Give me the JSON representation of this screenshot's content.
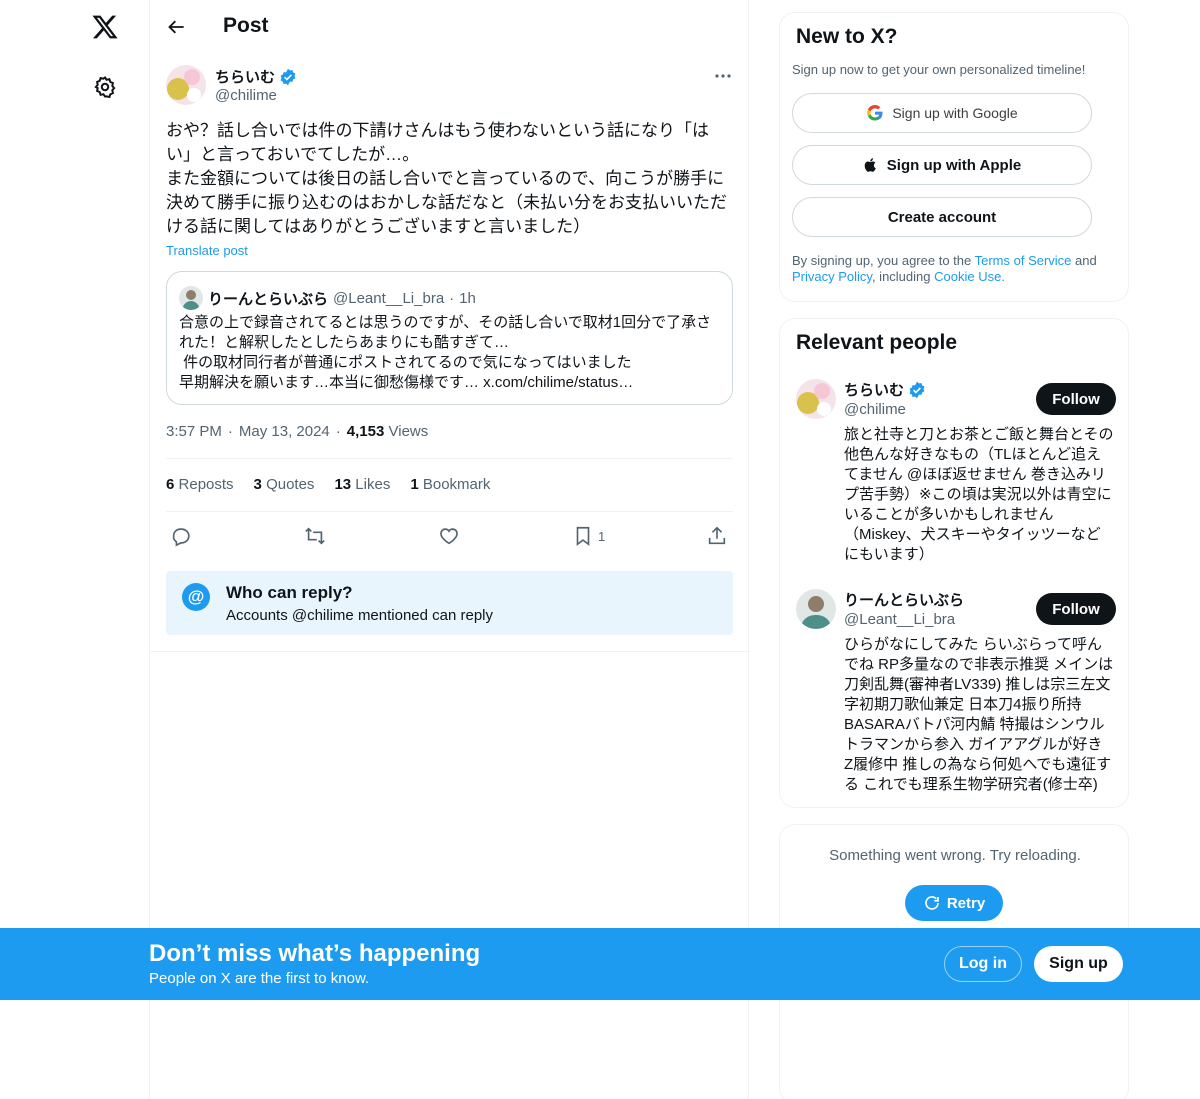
{
  "colors": {
    "accent": "#1d9bf0",
    "text": "#0f1419",
    "muted": "#536471",
    "border": "#eff3f4",
    "reply_bg": "#e8f5fd"
  },
  "nav": {
    "logo_icon": "x-logo-icon",
    "settings_icon": "gear-icon"
  },
  "header": {
    "title": "Post",
    "back_icon": "arrow-left-icon"
  },
  "post": {
    "author_name": "ちらいむ",
    "author_handle": "@chilime",
    "text": "おや？話し合いでは件の下請けさんはもう使わないという話になり「はい」と言っておいでてしたが…。\nまた金額については後日の話し合いでと言っているので、向こうが勝手に決めて勝手に振り込むのはおかしな話だなと（未払い分をお支払いいただける話に関してはありがとうございますと言いました）",
    "translate": "Translate post",
    "quote": {
      "name": "りーんとらいぶら",
      "handle": "@Leant__Li_bra",
      "separator": "·",
      "time": "1h",
      "text": "合意の上で録音されてるとは思うのですが、その話し合いで取材1回分で了承された！と解釈したとしたらあまりにも酷すぎて…\n 件の取材同行者が普通にポストされてるので気になってはいました\n早期解決を願います…本当に御愁傷様です… x.com/chilime/status…"
    },
    "time": "3:57 PM",
    "date": "May 13, 2024",
    "dot": "·",
    "views_count": "4,153",
    "views_label": "Views",
    "stats": {
      "reposts_count": "6",
      "reposts_label": "Reposts",
      "quotes_count": "3",
      "quotes_label": "Quotes",
      "likes_count": "13",
      "likes_label": "Likes",
      "bookmarks_count": "1",
      "bookmarks_label": "Bookmark"
    },
    "bookmark_action_count": "1",
    "who_can_reply": {
      "title": "Who can reply?",
      "subtitle": "Accounts @chilime mentioned can reply",
      "icon_glyph": "@"
    }
  },
  "sidebar": {
    "new_to_x": {
      "title": "New to X?",
      "subtitle": "Sign up now to get your own personalized timeline!",
      "google": "Sign up with Google",
      "apple": "Sign up with Apple",
      "create": "Create account",
      "legal_pre": "By signing up, you agree to the ",
      "terms": "Terms of Service",
      "and": " and ",
      "privacy": "Privacy Policy",
      "including": ", including ",
      "cookie": "Cookie Use",
      "period": "."
    },
    "relevant": {
      "title": "Relevant people",
      "people": [
        {
          "name": "ちらいむ",
          "handle": "@chilime",
          "follow": "Follow",
          "verified": true,
          "bio": "旅と社寺と刀とお茶とご飯と舞台とその他色んな好きなもの（TLほとんど追えてません @ほぼ返せません 巻き込みリプ苦手勢）※この頃は実況以外は青空にいることが多いかもしれません（Miskey、犬スキーやタイッツーなどにもいます）"
        },
        {
          "name": "りーんとらいぶら",
          "handle": "@Leant__Li_bra",
          "follow": "Follow",
          "verified": false,
          "bio": "ひらがなにしてみた らいぶらって呼んでね RP多量なので非表示推奨 メインは刀剣乱舞(審神者LV339) 推しは宗三左文字初期刀歌仙兼定 日本刀4振り所持 BASARAバトパ河内鯖 特撮はシンウルトラマンから参入 ガイアアグルが好き Z履修中 推しの為なら何処へでも遠征する これでも理系生物学研究者(修士卒)"
        }
      ]
    },
    "error": {
      "text": "Something went wrong. Try reloading.",
      "retry": "Retry"
    }
  },
  "banner": {
    "title": "Don’t miss what’s happening",
    "subtitle": "People on X are the first to know.",
    "login": "Log in",
    "signup": "Sign up"
  }
}
